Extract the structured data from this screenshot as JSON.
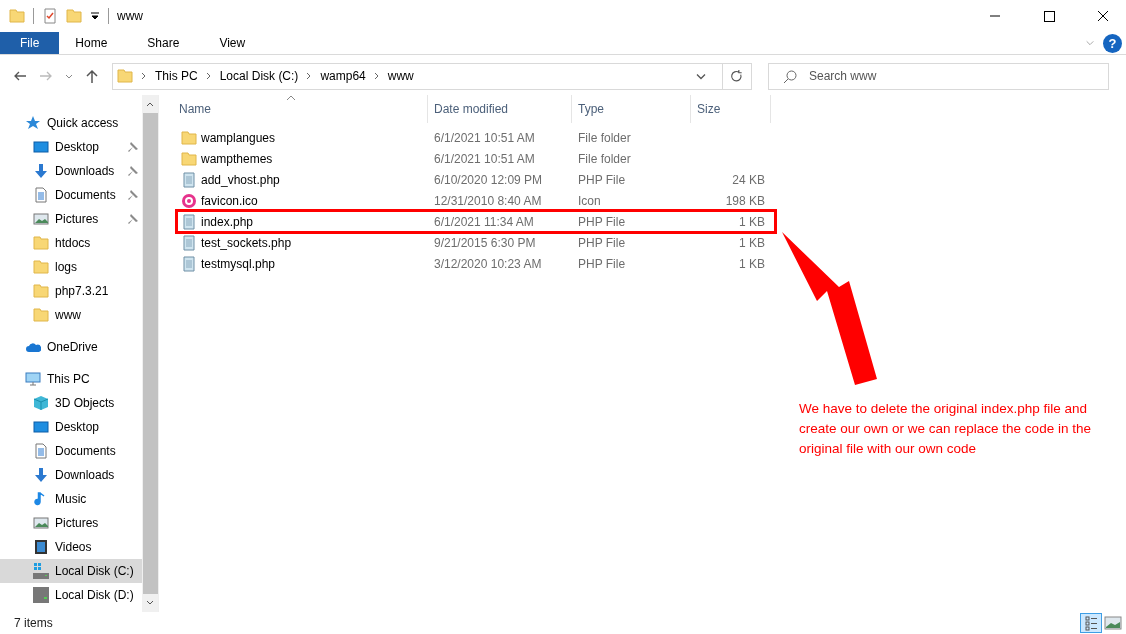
{
  "window": {
    "title": "www"
  },
  "help_button": {
    "label": "?"
  },
  "ribbon_tabs": [
    {
      "label": "File",
      "selected": true
    },
    {
      "label": "Home",
      "selected": false
    },
    {
      "label": "Share",
      "selected": false
    },
    {
      "label": "View",
      "selected": false
    }
  ],
  "address_bar": {
    "path": [
      "This PC",
      "Local Disk (C:)",
      "wamp64",
      "www"
    ]
  },
  "search": {
    "placeholder": "Search www"
  },
  "sidebar": {
    "items": [
      {
        "label": "Quick access",
        "kind": "star",
        "selected": false,
        "children": [
          {
            "label": "Desktop",
            "kind": "desktop",
            "pinned": true,
            "selected": false
          },
          {
            "label": "Downloads",
            "kind": "download",
            "pinned": true,
            "selected": false
          },
          {
            "label": "Documents",
            "kind": "document",
            "pinned": true,
            "selected": false
          },
          {
            "label": "Pictures",
            "kind": "picture",
            "pinned": true,
            "selected": false
          },
          {
            "label": "htdocs",
            "kind": "folder",
            "pinned": false,
            "selected": false
          },
          {
            "label": "logs",
            "kind": "folder",
            "pinned": false,
            "selected": false
          },
          {
            "label": "php7.3.21",
            "kind": "folder",
            "pinned": false,
            "selected": false
          },
          {
            "label": "www",
            "kind": "folder",
            "pinned": false,
            "selected": false
          }
        ]
      },
      {
        "label": "OneDrive",
        "kind": "cloud",
        "selected": false
      },
      {
        "label": "This PC",
        "kind": "computer",
        "selected": false,
        "children": [
          {
            "label": "3D Objects",
            "kind": "cube",
            "pinned": false,
            "selected": false
          },
          {
            "label": "Desktop",
            "kind": "desktop",
            "pinned": false,
            "selected": false
          },
          {
            "label": "Documents",
            "kind": "document",
            "pinned": false,
            "selected": false
          },
          {
            "label": "Downloads",
            "kind": "download",
            "pinned": false,
            "selected": false
          },
          {
            "label": "Music",
            "kind": "music",
            "pinned": false,
            "selected": false
          },
          {
            "label": "Pictures",
            "kind": "picture",
            "pinned": false,
            "selected": false
          },
          {
            "label": "Videos",
            "kind": "video",
            "pinned": false,
            "selected": false
          },
          {
            "label": "Local Disk (C:)",
            "kind": "drive-windows",
            "pinned": false,
            "selected": true
          },
          {
            "label": "Local Disk (D:)",
            "kind": "drive",
            "pinned": false,
            "selected": false
          }
        ]
      }
    ]
  },
  "table": {
    "columns": [
      "Name",
      "Date modified",
      "Type",
      "Size"
    ],
    "rows": [
      {
        "kind": "folder",
        "name": "wamplangues",
        "date": "6/1/2021 10:51 AM",
        "type": "File folder",
        "highlighted": false
      },
      {
        "kind": "folder",
        "name": "wampthemes",
        "date": "6/1/2021 10:51 AM",
        "type": "File folder",
        "highlighted": false
      },
      {
        "kind": "php",
        "name": "add_vhost.php",
        "date": "6/10/2020 12:09 PM",
        "type": "PHP File",
        "size": "24 KB",
        "highlighted": false
      },
      {
        "kind": "ico",
        "name": "favicon.ico",
        "date": "12/31/2010 8:40 AM",
        "type": "Icon",
        "size": "198 KB",
        "highlighted": false
      },
      {
        "kind": "php",
        "name": "index.php",
        "date": "6/1/2021 11:34 AM",
        "type": "PHP File",
        "size": "1 KB",
        "highlighted": true
      },
      {
        "kind": "php",
        "name": "test_sockets.php",
        "date": "9/21/2015 6:30 PM",
        "type": "PHP File",
        "size": "1 KB",
        "highlighted": false
      },
      {
        "kind": "php",
        "name": "testmysql.php",
        "date": "3/12/2020 10:23 AM",
        "type": "PHP File",
        "size": "1 KB",
        "highlighted": false
      }
    ]
  },
  "annotation": {
    "text": "We have to delete the original index.php file and create our own or we can replace the code in the original file with our own code"
  },
  "status_bar": {
    "text": "7 items",
    "view_buttons": [
      {
        "kind": "details",
        "selected": true
      },
      {
        "kind": "icons",
        "selected": false
      }
    ]
  }
}
